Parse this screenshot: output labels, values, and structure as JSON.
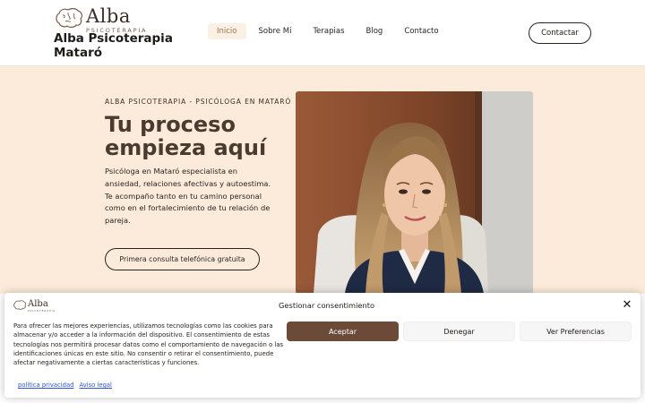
{
  "header": {
    "logo_name": "Alba",
    "logo_sub": "PSICOTERAPIA",
    "site_title": "Alba Psicoterapia Mataró",
    "nav": [
      "Inicio",
      "Sobre Mi",
      "Terapias",
      "Blog",
      "Contacto"
    ],
    "active_nav": "Inicio",
    "cta_label": "Contactar"
  },
  "hero": {
    "eyebrow": "ALBA PSICOTERAPIA - PSICÓLOGA EN MATARÓ",
    "heading": "Tu proceso empieza aquí",
    "description": "Psicóloga en Mataró especialista en ansiedad, relaciones afectivas y autoestima. Te acompaño tanto en tu camino personal como en el fortalecimiento de tu relación de pareja.",
    "cta_label": "Primera consulta telefónica gratuita"
  },
  "consent": {
    "logo_name": "Alba",
    "logo_sub": "PSICOTERAPIA",
    "title": "Gestionar consentimiento",
    "text": "Para ofrecer las mejores experiencias, utilizamos tecnologías como las cookies para almacenar y/o acceder a la información del dispositivo. El consentimiento de estas tecnologías nos permitirá procesar datos como el comportamiento de navegación o las identificaciones únicas en este sitio. No consentir o retirar el consentimiento, puede afectar negativamente a ciertas características y funciones.",
    "accept_label": "Aceptar",
    "deny_label": "Denegar",
    "prefs_label": "Ver Preferencias",
    "privacy_link": "política privacidad",
    "legal_link": "Aviso legal",
    "close_icon": "✕",
    "accent_color": "#6b4a37"
  },
  "colors": {
    "hero_bg": "#fcebda",
    "heading": "#4a3a30",
    "link": "#2f55c9"
  }
}
